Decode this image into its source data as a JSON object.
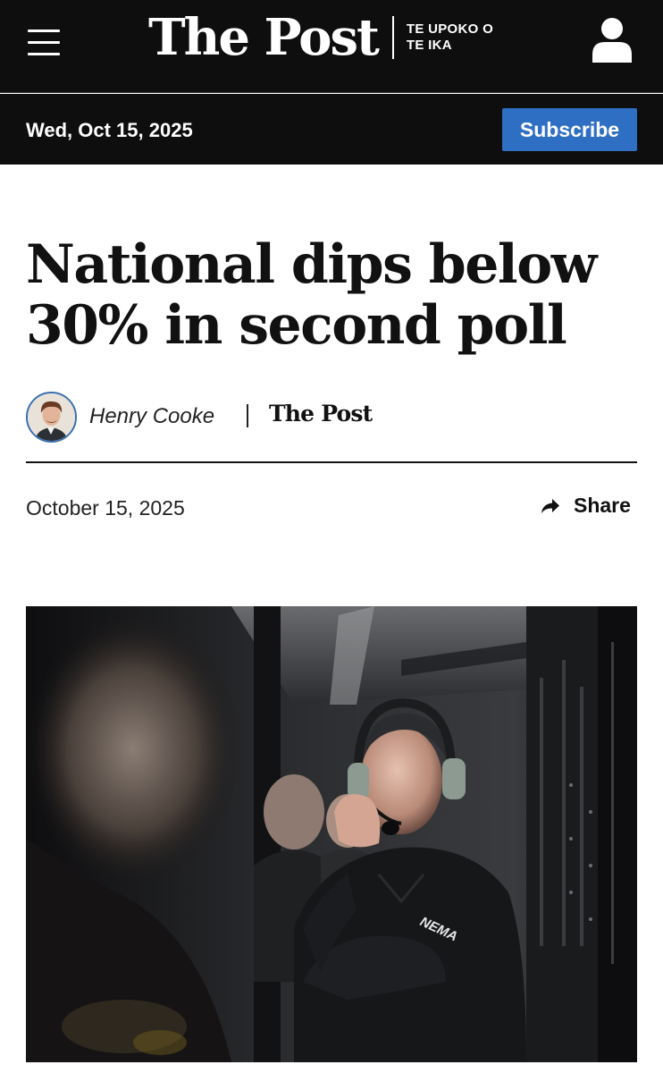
{
  "header": {
    "menu_icon": "hamburger-menu-icon",
    "masthead_title": "The Post",
    "masthead_tagline": "TE UPOKO O TE IKA",
    "account_icon": "user-account-icon"
  },
  "date_bar": {
    "date": "Wed, Oct 15, 2025",
    "subscribe_label": "Subscribe",
    "subscribe_color": "#2e6fc4"
  },
  "article": {
    "headline": "National dips below 30% in second poll",
    "author": "Henry Cooke",
    "publication": "The Post",
    "date": "October 15, 2025",
    "share_label": "Share",
    "share_icon": "share-arrow-icon",
    "hero_jacket_text": "NEMA"
  }
}
